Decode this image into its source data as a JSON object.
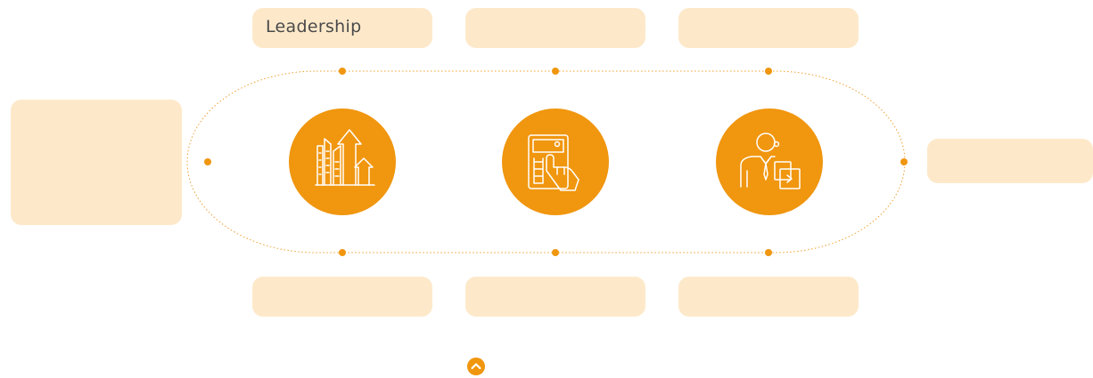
{
  "colors": {
    "accent": "#f0960f",
    "card": "#fde9ca",
    "line": "#f0a032",
    "text": "#4a4a4a"
  },
  "labels": {
    "top_left": "Leadership",
    "top_middle": "",
    "top_right": "",
    "bottom_left": "",
    "bottom_middle": "",
    "bottom_right": "",
    "left_panel": "",
    "right_panel": ""
  },
  "icons": [
    "growth-buildings-icon",
    "calculator-hand-icon",
    "businessman-documents-icon",
    "scroll-up-icon"
  ]
}
